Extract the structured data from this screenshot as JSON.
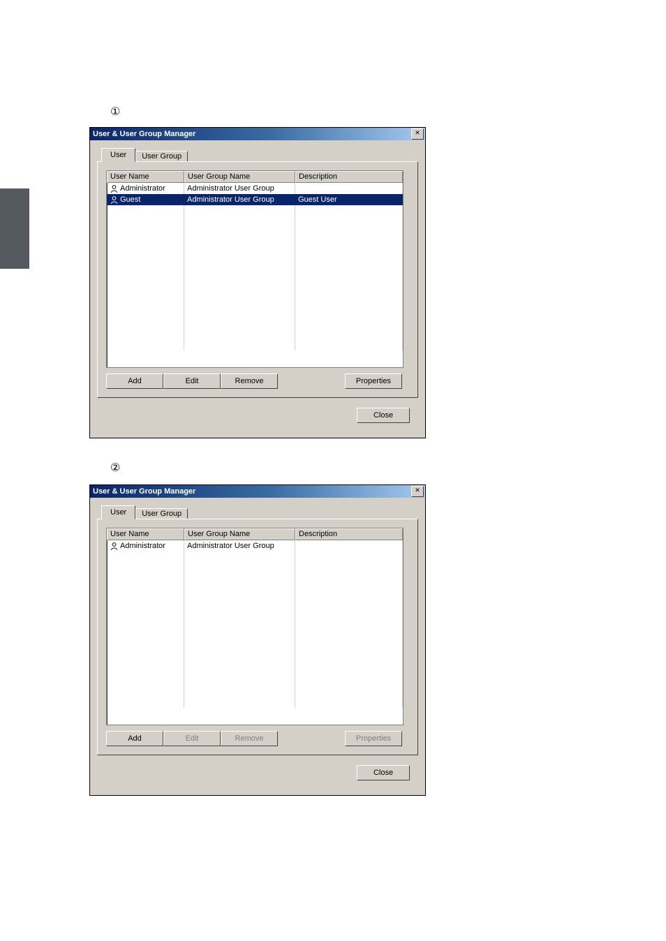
{
  "markers": {
    "one": "①",
    "two": "②"
  },
  "dialog1": {
    "title": "User & User Group Manager",
    "tabs": {
      "user": "User",
      "group": "User Group"
    },
    "columns": {
      "c0": "User Name",
      "c1": "User Group Name",
      "c2": "Description"
    },
    "rows": [
      {
        "name": "Administrator",
        "group": "Administrator User Group",
        "desc": "",
        "selected": false
      },
      {
        "name": "Guest",
        "group": "Administrator User Group",
        "desc": "Guest User",
        "selected": true
      }
    ],
    "buttons": {
      "add": "Add",
      "edit": "Edit",
      "remove": "Remove",
      "props": "Properties",
      "close": "Close"
    }
  },
  "dialog2": {
    "title": "User & User Group Manager",
    "tabs": {
      "user": "User",
      "group": "User Group"
    },
    "columns": {
      "c0": "User Name",
      "c1": "User Group Name",
      "c2": "Description"
    },
    "rows": [
      {
        "name": "Administrator",
        "group": "Administrator User Group",
        "desc": "",
        "selected": false
      }
    ],
    "buttons": {
      "add": "Add",
      "edit": "Edit",
      "remove": "Remove",
      "props": "Properties",
      "close": "Close"
    }
  }
}
